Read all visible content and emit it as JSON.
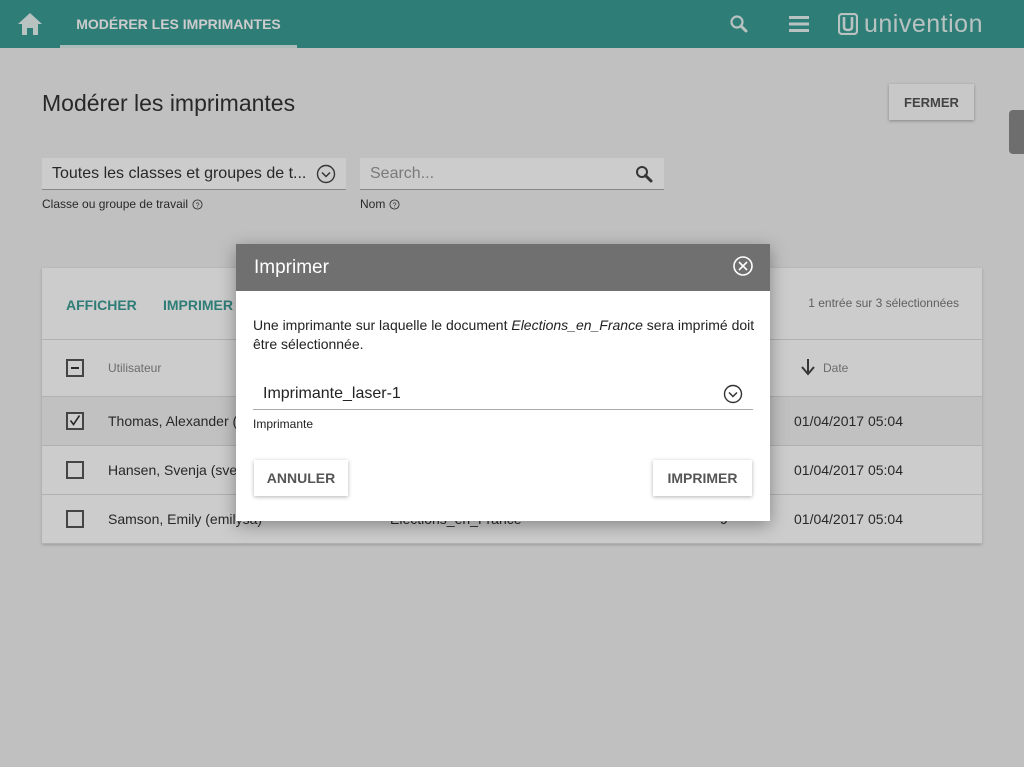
{
  "topbar": {
    "tab_label": "MODÉRER LES IMPRIMANTES",
    "brand": "univention",
    "color": "#3a9d95"
  },
  "page": {
    "title": "Modérer les imprimantes",
    "close_label": "FERMER"
  },
  "filters": {
    "class_value": "Toutes les classes et groupes de t...",
    "class_label": "Classe ou groupe de travail",
    "search_placeholder": "Search...",
    "search_label": "Nom"
  },
  "grid": {
    "actions": [
      "AFFICHER",
      "IMPRIMER"
    ],
    "status": "1 entrée sur 3 sélectionnées",
    "columns": {
      "user": "Utilisateur",
      "date": "Date"
    },
    "rows": [
      {
        "user": "Thomas, Alexander (",
        "doc": "",
        "pages": "",
        "date": "01/04/2017 05:04",
        "selected": true
      },
      {
        "user": "Hansen, Svenja (sver",
        "doc": "",
        "pages": "",
        "date": "01/04/2017 05:04",
        "selected": false
      },
      {
        "user": "Samson, Emily (emilysa)",
        "doc": "Elections_en_France",
        "pages": "9",
        "date": "01/04/2017 05:04",
        "selected": false
      }
    ]
  },
  "dialog": {
    "title": "Imprimer",
    "message_before": "Une imprimante sur laquelle le document ",
    "message_doc": "Elections_en_France",
    "message_after": " sera imprimé doit être sélectionnée.",
    "printer_value": "Imprimante_laser-1",
    "printer_label": "Imprimante",
    "cancel_label": "ANNULER",
    "print_label": "IMPRIMER"
  }
}
